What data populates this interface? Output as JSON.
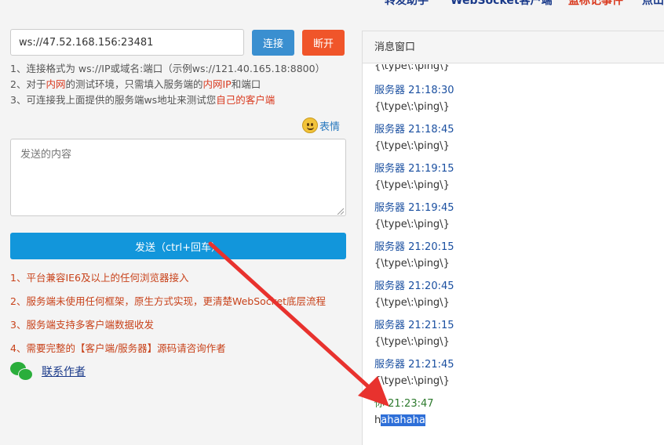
{
  "topnav": {
    "items": [
      "转发助手",
      "WebSocket客户端",
      "蓝标记事件",
      "点山"
    ]
  },
  "connection": {
    "url_value": "ws://47.52.168.156:23481",
    "connect_label": "连接",
    "disconnect_label": "断开"
  },
  "hints": {
    "line1": "1、连接格式为 ws://IP或域名:端口（示例ws://121.40.165.18:8800）",
    "line2_a": "2、对于",
    "line2_hl1": "内网",
    "line2_b": "的测试环境，只需填入服务端的",
    "line2_hl2": "内网IP",
    "line2_c": "和端口",
    "line3_a": "3、可连接我上面提供的服务端ws地址来测试您",
    "line3_hl": "自己的客户端"
  },
  "emoji": {
    "label": "表情"
  },
  "compose": {
    "placeholder": "发送的内容",
    "send_label": "发送（ctrl+回车）"
  },
  "features": [
    "1、平台兼容IE6及以上的任何浏览器接入",
    "2、服务端未使用任何框架，原生方式实现，更清楚WebSocket底层流程",
    "3、服务端支持多客户端数据收发",
    "4、需要完整的【客户端/服务器】源码请咨询作者"
  ],
  "contact": {
    "label": "联系作者"
  },
  "panel": {
    "title": "消息窗口",
    "messages": [
      {
        "sender": "",
        "content": "{\\type\\:\\ping\\}"
      },
      {
        "sender": "服务器 21:18:30",
        "content": "{\\type\\:\\ping\\}"
      },
      {
        "sender": "服务器 21:18:45",
        "content": "{\\type\\:\\ping\\}"
      },
      {
        "sender": "服务器 21:19:15",
        "content": "{\\type\\:\\ping\\}"
      },
      {
        "sender": "服务器 21:19:45",
        "content": "{\\type\\:\\ping\\}"
      },
      {
        "sender": "服务器 21:20:15",
        "content": "{\\type\\:\\ping\\}"
      },
      {
        "sender": "服务器 21:20:45",
        "content": "{\\type\\:\\ping\\}"
      },
      {
        "sender": "服务器 21:21:15",
        "content": "{\\type\\:\\ping\\}"
      },
      {
        "sender": "服务器 21:21:45",
        "content": "{\\type\\:\\ping\\}"
      }
    ],
    "self_message": {
      "sender": "你 21:23:47",
      "content_prefix": "h",
      "content_selected": "ahahaha"
    }
  },
  "colors": {
    "connect_button": "#3a8fd0",
    "disconnect_button": "#f0552a",
    "send_button": "#1296db",
    "highlight_text": "#d9391e",
    "annotation_arrow": "#e8322e"
  }
}
